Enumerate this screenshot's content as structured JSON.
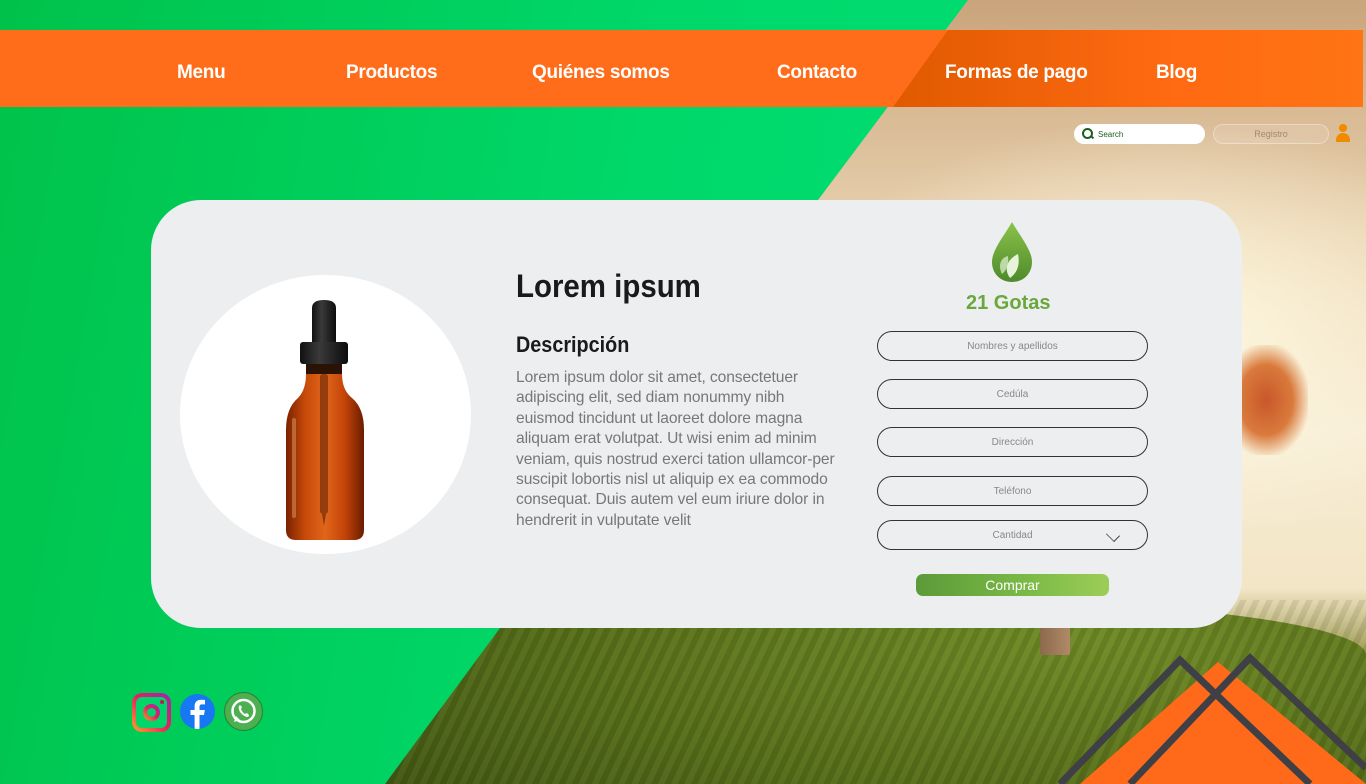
{
  "nav": {
    "items": [
      {
        "label": "Menu"
      },
      {
        "label": "Productos"
      },
      {
        "label": "Quiénes somos"
      },
      {
        "label": "Contacto"
      },
      {
        "label": "Formas de pago"
      },
      {
        "label": "Blog"
      }
    ]
  },
  "search": {
    "placeholder": "Search"
  },
  "registro": {
    "label": "Registro"
  },
  "product": {
    "title": "Lorem ipsum",
    "subtitle": "Descripción",
    "description": "Lorem ipsum dolor sit amet, consectetuer adipiscing elit, sed diam nonummy nibh euismod tincidunt ut laoreet dolore magna aliquam erat volutpat. Ut wisi enim ad minim veniam, quis nostrud exerci tation ullamcor-per suscipit lobortis nisl ut aliquip ex ea commodo consequat. Duis autem vel eum iriure dolor in hendrerit in vulputate velit"
  },
  "brand": {
    "name": "21 Gotas"
  },
  "form": {
    "name_placeholder": "Nombres y apellidos",
    "id_placeholder": "Cedúla",
    "address_placeholder": "Dirección",
    "phone_placeholder": "Teléfono",
    "quantity_label": "Cantidad",
    "buy_label": "Comprar"
  },
  "social": {
    "icons": [
      "instagram-icon",
      "facebook-icon",
      "whatsapp-icon"
    ]
  },
  "colors": {
    "nav_orange": "#ff6d1a",
    "green_bg": "#00d86a",
    "brand_green": "#6aa83d",
    "card_bg": "#eceef0"
  }
}
